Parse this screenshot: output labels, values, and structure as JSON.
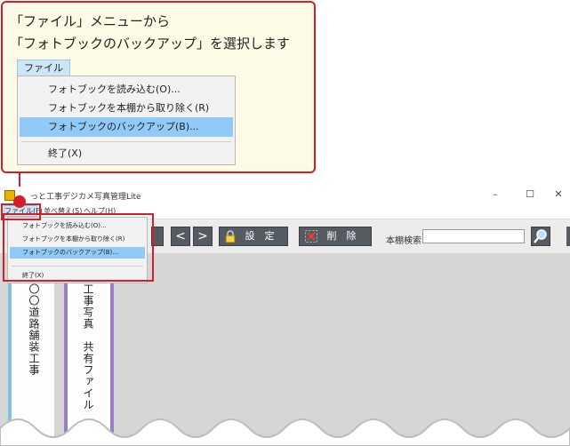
{
  "callout": {
    "line1": "「ファイル」メニューから",
    "line2": "「フォトブックのバックアップ」を選択します",
    "menu_button": "ファイル(F)",
    "items": [
      {
        "label": "フォトブックを読み込む(O)..."
      },
      {
        "label": "フォトブックを本棚から取り除く(R)"
      },
      {
        "label": "フォトブックのバックアップ(B)..."
      },
      {
        "label": "終了(X)"
      }
    ],
    "selected_index": 2
  },
  "window": {
    "title": "っと工事デジカメ写真管理Lite",
    "controls": {
      "minimize": "–",
      "maximize": "☐",
      "close": "✕"
    },
    "menubar": {
      "file": "ファイル(F)",
      "sort": "並べ替え(S)",
      "help": "ヘルプ(H)"
    },
    "toolbar": {
      "prev": "<",
      "next": ">",
      "settings": "設　定",
      "delete": "削　除",
      "search_label": "本棚検索",
      "search_value": ""
    },
    "dropdown": {
      "items": [
        {
          "label": "フォトブックを読み込む(O)..."
        },
        {
          "label": "フォトブックを本棚から取り除く(R)"
        },
        {
          "label": "フォトブックのバックアップ(B)..."
        },
        {
          "label": "終了(X)"
        }
      ]
    },
    "books": [
      {
        "title": "〇〇道路舗装工事"
      },
      {
        "title": "工事写真　共有ファイル"
      }
    ]
  },
  "colors": {
    "accent_red": "#d21f2a",
    "selection_blue": "#91c9f7",
    "toolbar_button": "#555b62",
    "book1_stripe": "#7fc3dc",
    "book2_stripe": "#9b7fc6"
  },
  "icons": [
    "app-icon",
    "chevron-left-icon",
    "chevron-right-icon",
    "lock-icon",
    "delete-x-icon",
    "magnifier-icon"
  ]
}
